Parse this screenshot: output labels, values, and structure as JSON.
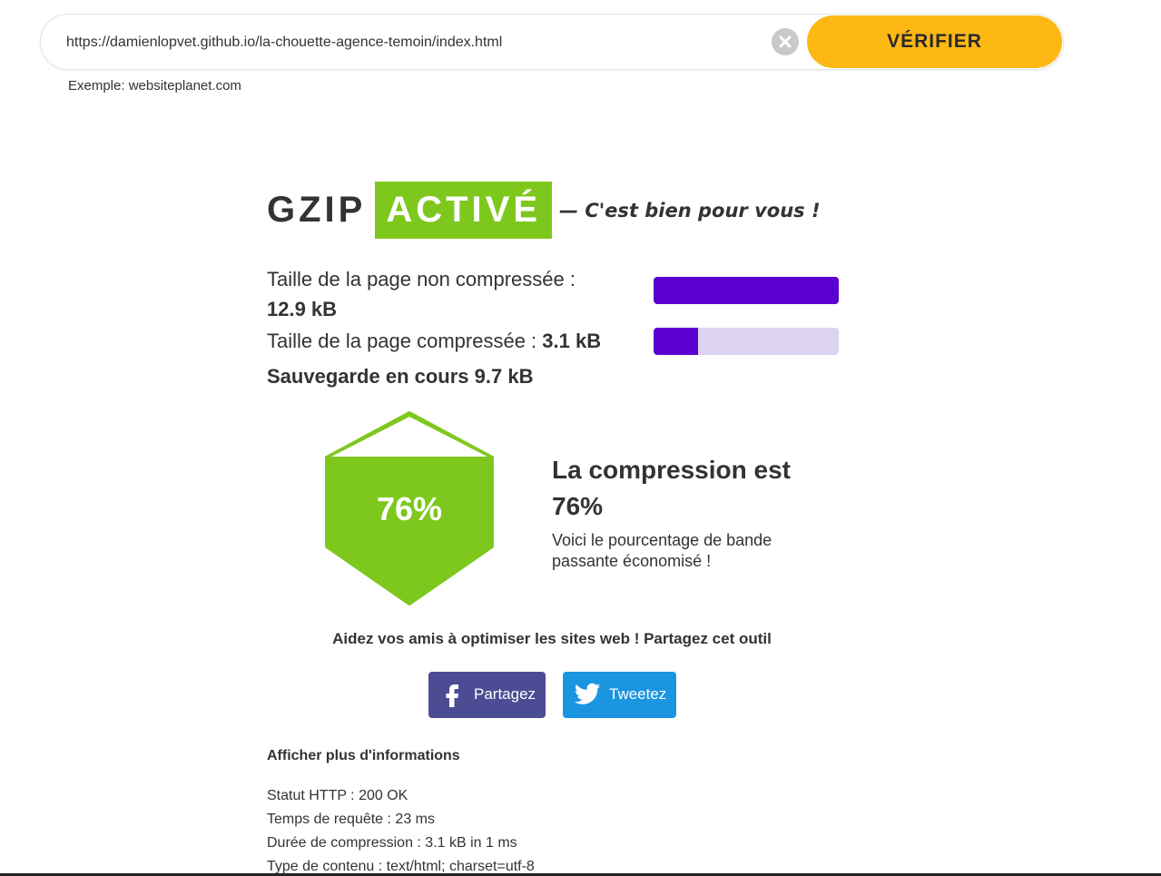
{
  "search": {
    "url_value": "https://damienlopvet.github.io/la-chouette-agence-temoin/index.html",
    "verify_label": "VÉRIFIER",
    "example_text": "Exemple: websiteplanet.com"
  },
  "result": {
    "gzip_label": "GZIP",
    "status_badge": "ACTIVÉ",
    "tagline": "— C'est bien pour vous !",
    "uncompressed_label": "Taille de la page non compressée :",
    "uncompressed_value": "12.9 kB",
    "compressed_label": "Taille de la page compressée :",
    "compressed_value": "3.1 kB",
    "savings_text": "Sauvegarde en cours 9.7 kB",
    "uncompressed_bar_fraction": 1.0,
    "compressed_bar_fraction": 0.24,
    "hexagon_value": "76%",
    "compression_title": "La compression est",
    "compression_value": "76%",
    "compression_desc": "Voici le pourcentage de bande passante économisé !"
  },
  "share": {
    "title": "Aidez vos amis à optimiser les sites web ! Partagez cet outil",
    "facebook_label": "Partagez",
    "twitter_label": "Tweetez"
  },
  "info": {
    "more_label": "Afficher plus d'informations",
    "lines": [
      "Statut HTTP : 200 OK",
      "Temps de requête : 23 ms",
      "Durée de compression : 3.1 kB in 1 ms",
      "Type de contenu : text/html; charset=utf-8"
    ]
  },
  "colors": {
    "accent_yellow": "#fdb813",
    "green": "#7ec81e",
    "purple": "#5b00d0",
    "purple_light": "#dcd3f0",
    "facebook": "#4c4c94",
    "twitter": "#1b95e0"
  },
  "icons": [
    "clear-icon",
    "facebook-icon",
    "twitter-icon"
  ]
}
